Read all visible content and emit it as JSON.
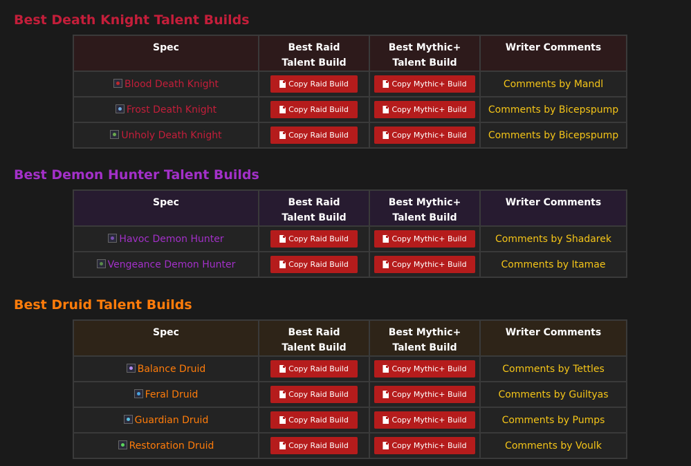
{
  "columns": {
    "spec": "Spec",
    "raid": [
      "Best Raid",
      "Talent Build"
    ],
    "mplus": [
      "Best Mythic+",
      "Talent Build"
    ],
    "comments": "Writer Comments"
  },
  "buttons": {
    "raid": "Copy Raid Build",
    "mplus": "Copy Mythic+ Build"
  },
  "sections": [
    {
      "title": "Best Death Knight Talent Builds",
      "color": "#c41e3a",
      "header_bg": "#2d1a1b",
      "rows": [
        {
          "spec": "Blood Death Knight",
          "icon": "blood-dk-icon",
          "icon_color": "#c0282c",
          "comment": "Comments by Mandl"
        },
        {
          "spec": "Frost Death Knight",
          "icon": "frost-dk-icon",
          "icon_color": "#6fa8dc",
          "comment": "Comments by Bicepspump"
        },
        {
          "spec": "Unholy Death Knight",
          "icon": "unholy-dk-icon",
          "icon_color": "#6aa84f",
          "comment": "Comments by Bicepspump"
        }
      ]
    },
    {
      "title": "Best Demon Hunter Talent Builds",
      "color": "#a330c9",
      "header_bg": "#271b30",
      "rows": [
        {
          "spec": "Havoc Demon Hunter",
          "icon": "havoc-dh-icon",
          "icon_color": "#7a4fb0",
          "comment": "Comments by Shadarek"
        },
        {
          "spec": "Vengeance Demon Hunter",
          "icon": "vengeance-dh-icon",
          "icon_color": "#5a8a4a",
          "comment": "Comments by Itamae"
        }
      ]
    },
    {
      "title": "Best Druid Talent Builds",
      "color": "#ff7c0a",
      "header_bg": "#2e2418",
      "rows": [
        {
          "spec": "Balance Druid",
          "icon": "balance-druid-icon",
          "icon_color": "#b48cf0",
          "comment": "Comments by Tettles"
        },
        {
          "spec": "Feral Druid",
          "icon": "feral-druid-icon",
          "icon_color": "#4aa3df",
          "comment": "Comments by Guiltyas"
        },
        {
          "spec": "Guardian Druid",
          "icon": "guardian-druid-icon",
          "icon_color": "#5bc0de",
          "comment": "Comments by Pumps"
        },
        {
          "spec": "Restoration Druid",
          "icon": "restoration-druid-icon",
          "icon_color": "#5cd65c",
          "comment": "Comments by Voulk"
        }
      ]
    }
  ]
}
